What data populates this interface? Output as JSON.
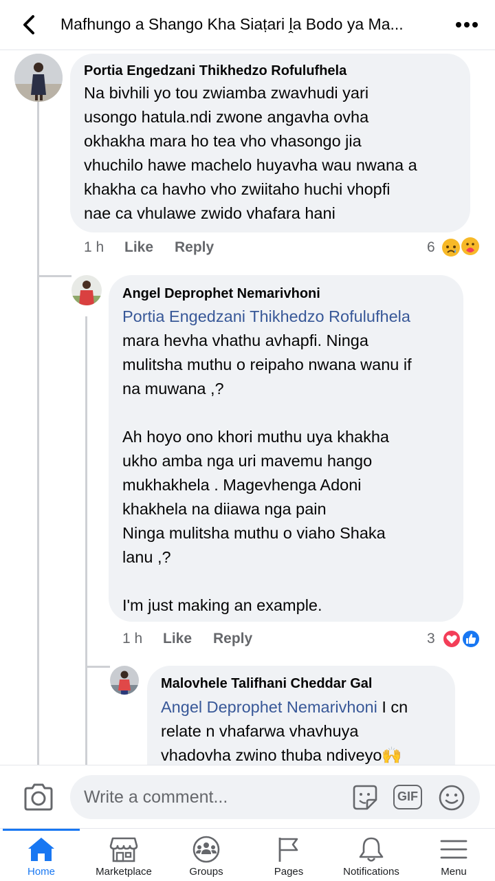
{
  "header": {
    "title": "Mafhungo a Shango Kha Siaṭari ḽa Bodo ya Ma..."
  },
  "comments": [
    {
      "author": "Portia Engedzani Thikhedzo Rofulufhela",
      "text": "Na bivhili yo tou zwiamba zwavhudi yari\nusongo hatula.ndi zwone angavha ovha\nokhakha mara ho tea vho vhasongo jia\nvhuchilo hawe machelo huyavha wau nwana a\nkhakha ca havho vho zwiitaho huchi vhopfi\nnae ca vhulawe zwido vhafara hani",
      "time": "1 h",
      "like_label": "Like",
      "reply_label": "Reply",
      "reaction_count": "6",
      "reactions": [
        "sad-icon",
        "care-icon"
      ]
    },
    {
      "author": "Angel Deprophet Nemarivhoni",
      "mention": "Portia Engedzani Thikhedzo Rofulufhela",
      "text": "mara hevha vhathu avhapfi. Ninga\nmulitsha muthu o reipaho nwana wanu if\nna muwana ,?\n\nAh hoyo ono khori muthu uya khakha\nukho amba nga uri mavemu hango\nmukhakhela . Magevhenga Adoni\nkhakhela na diiawa nga pain\nNinga mulitsha muthu o viaho Shaka\nlanu ,?\n\nI'm just making an example.",
      "time": "1 h",
      "like_label": "Like",
      "reply_label": "Reply",
      "reaction_count": "3",
      "reactions": [
        "love-icon",
        "like-icon"
      ]
    },
    {
      "author": "Malovhele Talifhani Cheddar Gal",
      "mention": "Angel Deprophet Nemarivhoni",
      "text_inline": " I cn",
      "text": "relate n vhafarwa vhavhuya\nvhadovha zwino thuba ndiveyo🙌"
    }
  ],
  "composer": {
    "placeholder": "Write a comment...",
    "gif_label": "GIF"
  },
  "tabs": [
    {
      "label": "Home",
      "icon": "home-icon",
      "active": true
    },
    {
      "label": "Marketplace",
      "icon": "marketplace-icon",
      "active": false
    },
    {
      "label": "Groups",
      "icon": "groups-icon",
      "active": false
    },
    {
      "label": "Pages",
      "icon": "pages-flag-icon",
      "active": false
    },
    {
      "label": "Notifications",
      "icon": "bell-icon",
      "active": false
    },
    {
      "label": "Menu",
      "icon": "menu-icon",
      "active": false
    }
  ],
  "colors": {
    "accent": "#1877f2",
    "mention": "#385898",
    "bubble": "#f0f2f5",
    "muted": "#65676b"
  }
}
